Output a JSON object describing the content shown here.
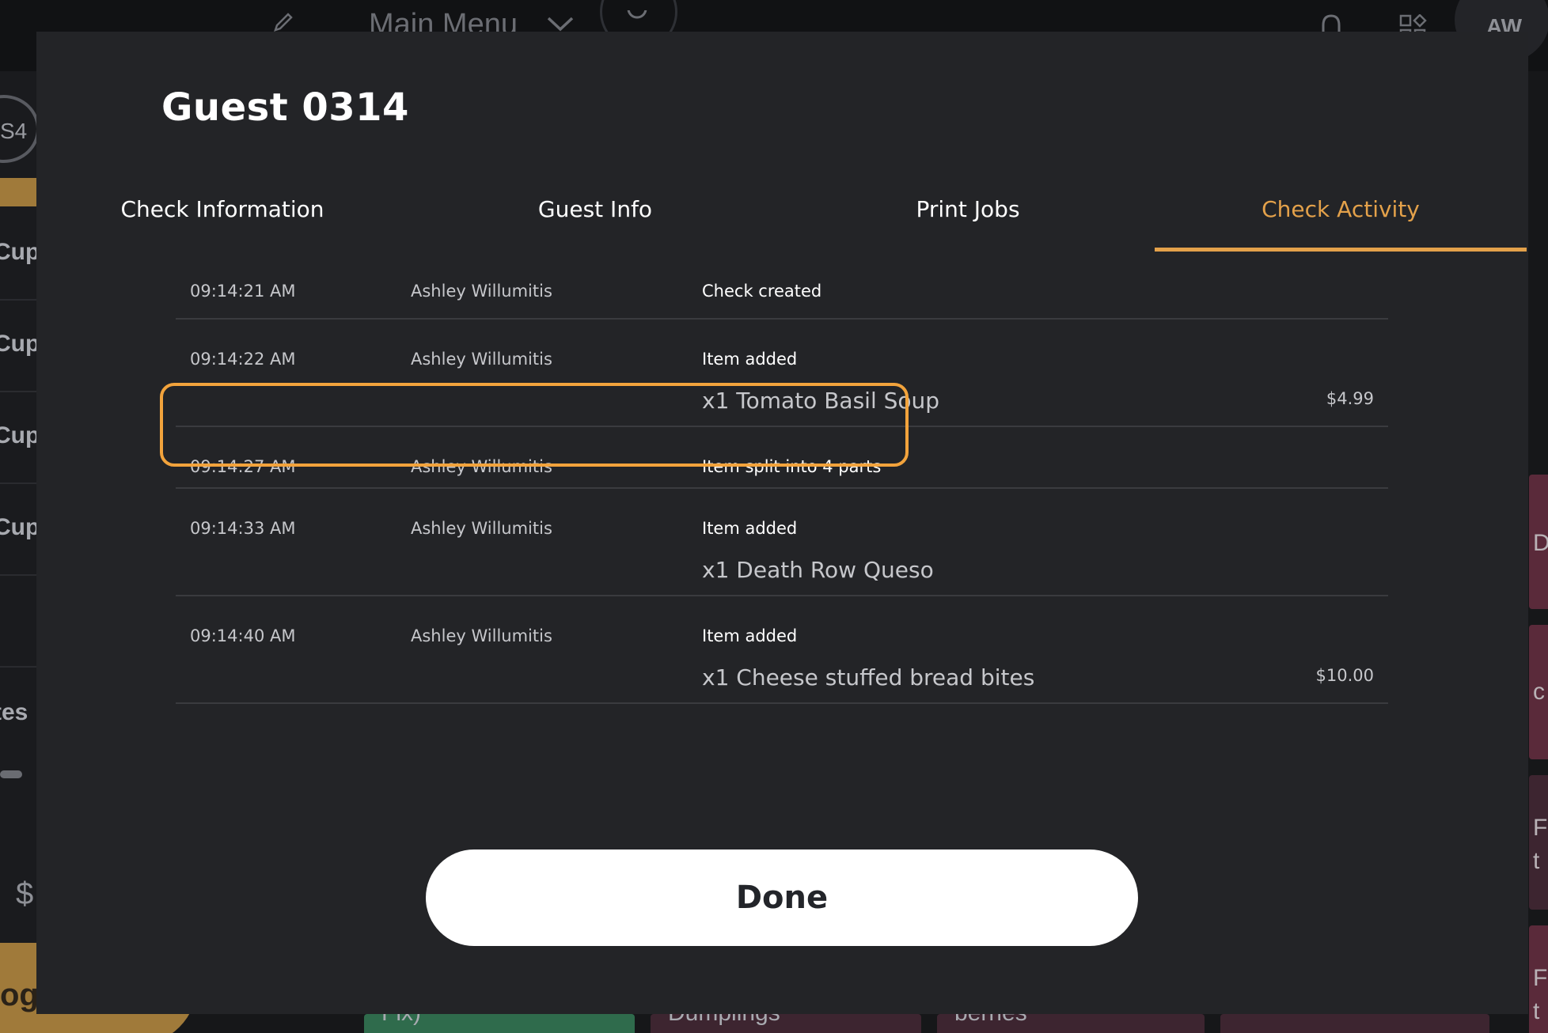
{
  "background": {
    "menu_title": "Main Menu",
    "avatar_initials": "AW",
    "seat_label": "S4",
    "left_words": [
      "Cup",
      "Cup",
      "Cup",
      "Cup",
      "tes"
    ],
    "dollar_fragment": "$",
    "gold_button_fragment": "og",
    "bottom_tiles": [
      "Fix)",
      "Dumplings",
      "berries"
    ],
    "right_fragments": [
      "D",
      "c",
      "F",
      "t",
      "F",
      "t"
    ]
  },
  "modal": {
    "title": "Guest 0314",
    "tabs": [
      {
        "label": "Check Information",
        "active": false
      },
      {
        "label": "Guest Info",
        "active": false
      },
      {
        "label": "Print Jobs",
        "active": false
      },
      {
        "label": "Check Activity",
        "active": true
      }
    ],
    "activity": [
      {
        "time": "09:14:21 AM",
        "user": "Ashley Willumitis",
        "event": "Check created",
        "detail": "",
        "amount": ""
      },
      {
        "time": "09:14:22 AM",
        "user": "Ashley Willumitis",
        "event": "Item added",
        "detail": "x1 Tomato Basil Soup",
        "amount": "$4.99"
      },
      {
        "time": "09:14:27 AM",
        "user": "Ashley Willumitis",
        "event": "Item split into 4 parts",
        "detail": "",
        "amount": ""
      },
      {
        "time": "09:14:33 AM",
        "user": "Ashley Willumitis",
        "event": "Item added",
        "detail": "x1 Death Row Queso",
        "amount": ""
      },
      {
        "time": "09:14:40 AM",
        "user": "Ashley Willumitis",
        "event": "Item added",
        "detail": "x1 Cheese stuffed bread bites",
        "amount": "$10.00"
      }
    ],
    "highlighted_row": 2,
    "done_label": "Done"
  },
  "colors": {
    "accent": "#e3a14a",
    "highlight_border": "#f2a33c",
    "modal_bg": "#232427"
  }
}
